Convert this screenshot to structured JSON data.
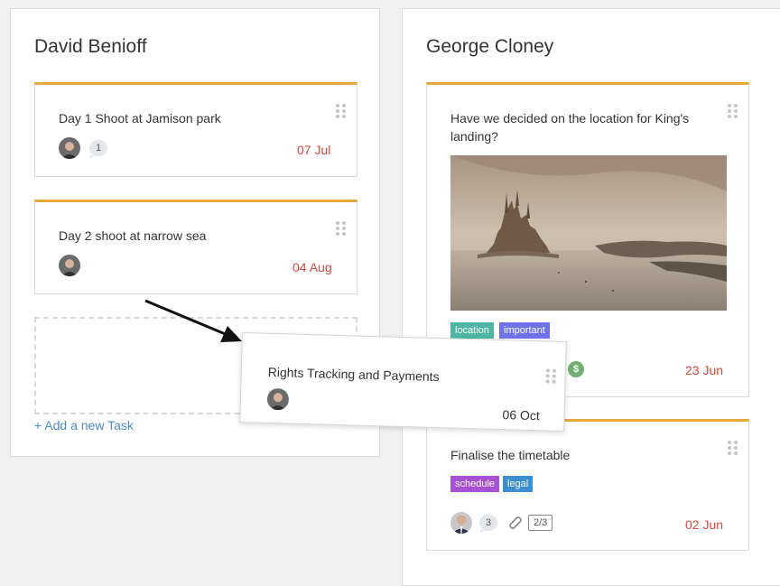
{
  "columns": [
    {
      "title": "David Benioff",
      "cards": [
        {
          "title": "Day 1 Shoot at Jamison park",
          "comments": "1",
          "date": "07 Jul"
        },
        {
          "title": "Day 2 shoot at narrow sea",
          "date": "04 Aug"
        }
      ],
      "add_task_label": "+ Add a new Task"
    },
    {
      "title": "George Cloney",
      "cards": [
        {
          "title": "Have we decided on the location for King's landing?",
          "tags": [
            {
              "label": "location",
              "color": "#4db6a4"
            },
            {
              "label": "important",
              "color": "#6f72e8"
            }
          ],
          "date": "23 Jun"
        },
        {
          "title": "Finalise the timetable",
          "tags": [
            {
              "label": "schedule",
              "color": "#a84fd4"
            },
            {
              "label": "legal",
              "color": "#3d8ed0"
            }
          ],
          "comments": "3",
          "checklist": "2/3",
          "date": "02 Jun"
        }
      ]
    }
  ],
  "dragging_card": {
    "title": "Rights Tracking and Payments",
    "date": "06 Oct"
  },
  "colors": {
    "accent": "#e5a63a",
    "date": "#d9473b",
    "link": "#4a8bc9"
  },
  "icons": [
    "drag-handle-icon",
    "comment-icon",
    "attachment-icon",
    "dollar-icon",
    "avatar"
  ]
}
